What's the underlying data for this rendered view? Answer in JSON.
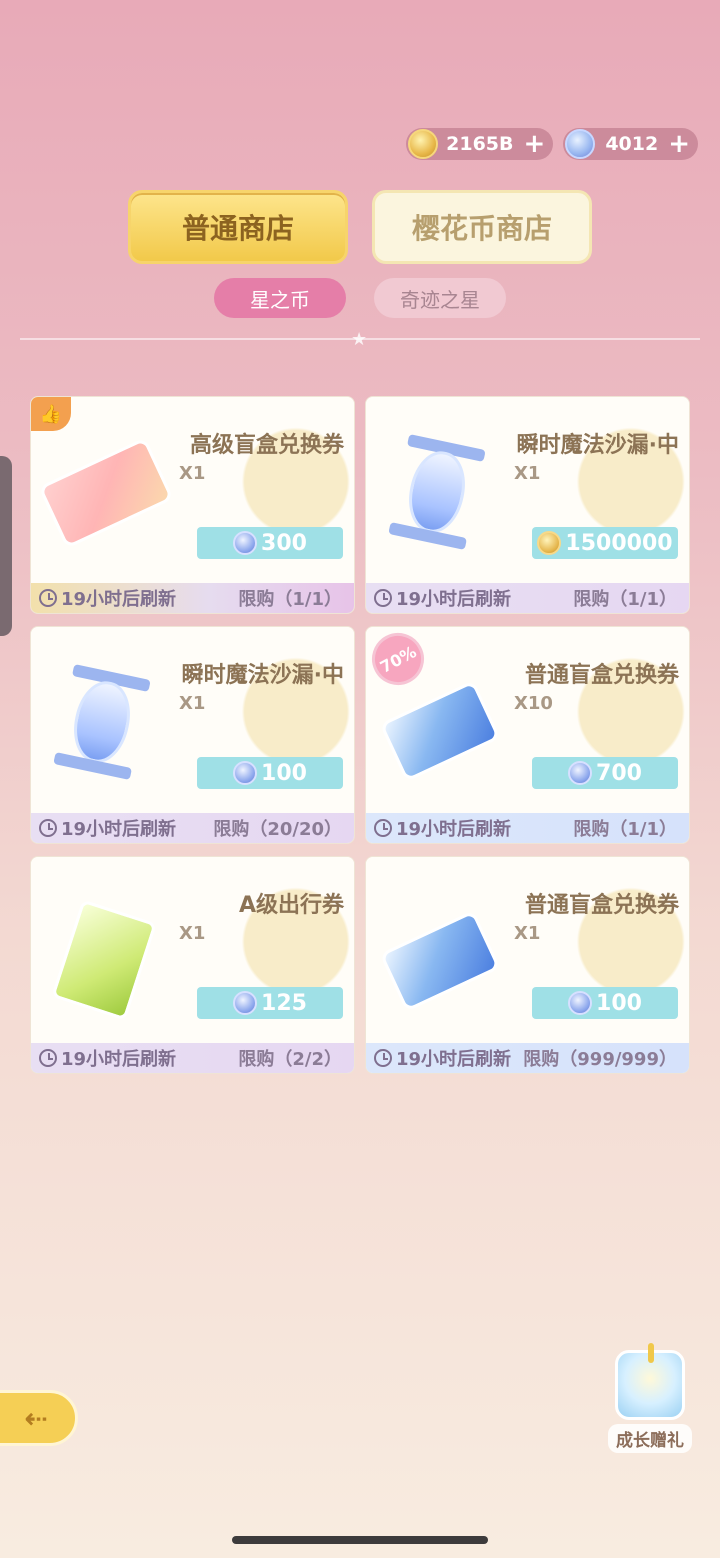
{
  "currency": {
    "coins": "2165B",
    "stars": "4012"
  },
  "shop_tabs": [
    {
      "label": "普通商店"
    },
    {
      "label": "樱花币商店"
    }
  ],
  "sub_tabs": [
    {
      "label": "星之币"
    },
    {
      "label": "奇迹之星"
    }
  ],
  "items": [
    {
      "name": "高级盲盒兑换券",
      "qty": "X1",
      "price": "300",
      "price_type": "star",
      "refresh": "19小时后刷新",
      "limit": "限购（1/1）"
    },
    {
      "name": "瞬时魔法沙漏·中",
      "qty": "X1",
      "price": "1500000",
      "price_type": "coin",
      "refresh": "19小时后刷新",
      "limit": "限购（1/1）"
    },
    {
      "name": "瞬时魔法沙漏·中",
      "qty": "X1",
      "price": "100",
      "price_type": "star",
      "refresh": "19小时后刷新",
      "limit": "限购（20/20）"
    },
    {
      "name": "普通盲盒兑换券",
      "qty": "X10",
      "price": "700",
      "price_type": "star",
      "refresh": "19小时后刷新",
      "limit": "限购（1/1）",
      "badge": "70%"
    },
    {
      "name": "A级出行券",
      "qty": "X1",
      "price": "125",
      "price_type": "star",
      "refresh": "19小时后刷新",
      "limit": "限购（2/2）"
    },
    {
      "name": "普通盲盒兑换券",
      "qty": "X1",
      "price": "100",
      "price_type": "star",
      "refresh": "19小时后刷新",
      "limit": "限购（999/999）"
    }
  ],
  "gift": {
    "label": "成长赠礼"
  },
  "icons": {
    "coin": "coin-icon",
    "star": "star-icon",
    "plus": "plus-icon",
    "clock": "clock-icon",
    "back": "back-icon",
    "gift": "gift-icon",
    "thumb": "thumb-up-icon"
  },
  "colors": {
    "active_tab": "#f2c94a",
    "active_subtab": "#e57ea8",
    "price_bg": "#9fe0e6",
    "text_brown": "#8c7355"
  }
}
